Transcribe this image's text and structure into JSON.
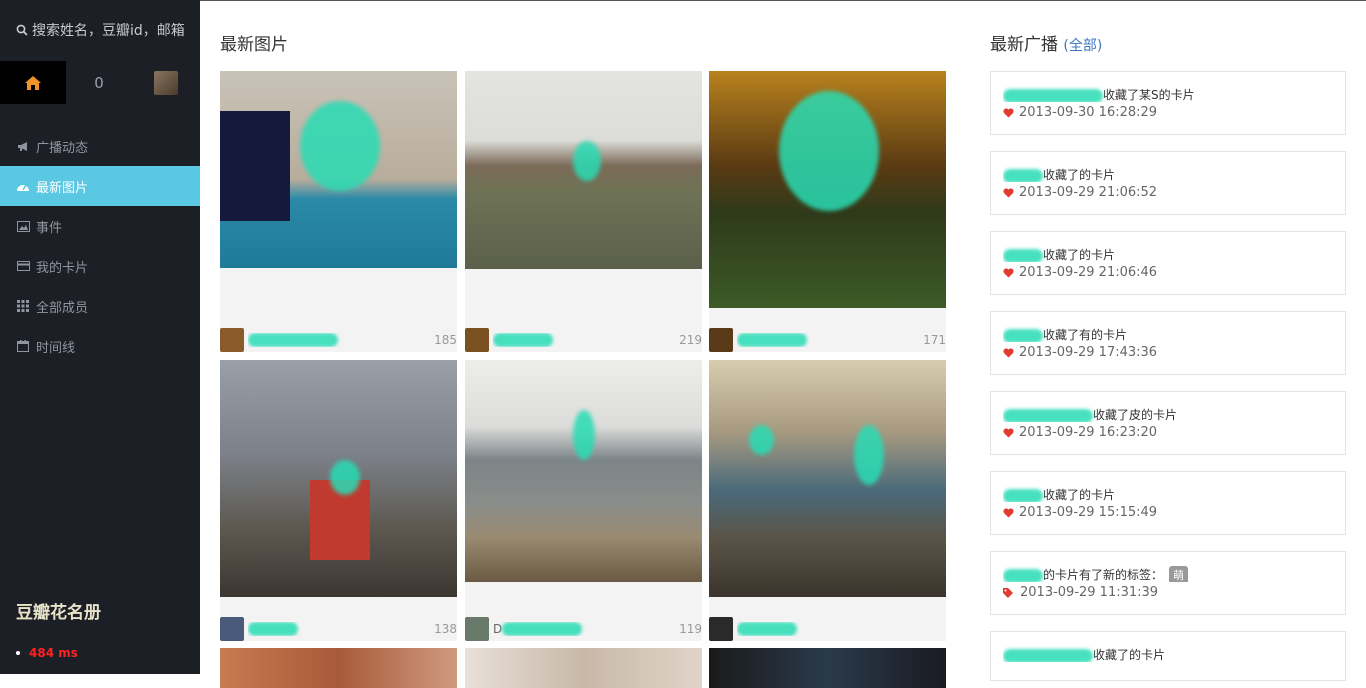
{
  "sidebar": {
    "search_placeholder": "搜索姓名，豆瓣id，邮箱",
    "count": "0",
    "nav": [
      {
        "label": "广播动态",
        "icon": "bullhorn-icon"
      },
      {
        "label": "最新图片",
        "icon": "dashboard-icon",
        "active": true
      },
      {
        "label": "事件",
        "icon": "picture-icon"
      },
      {
        "label": "我的卡片",
        "icon": "credit-card-icon"
      },
      {
        "label": "全部成员",
        "icon": "grid-icon"
      },
      {
        "label": "时间线",
        "icon": "calendar-icon"
      }
    ],
    "brand": "豆瓣花名册",
    "timing": "484 ms"
  },
  "photos": {
    "title": "最新图片",
    "items": [
      {
        "name": "",
        "count": "185"
      },
      {
        "name": "",
        "count": "219"
      },
      {
        "name": "",
        "count": "171"
      },
      {
        "name": "",
        "count": "138"
      },
      {
        "name": "D",
        "count": "119"
      },
      {
        "name": "",
        "count": ""
      }
    ]
  },
  "feed": {
    "title": "最新广播",
    "all_link": "(全部)",
    "items": [
      {
        "text": "收藏了某S的卡片",
        "time": "2013-09-30 16:28:29",
        "icon": "heart-icon"
      },
      {
        "text": "收藏了的卡片",
        "time": "2013-09-29 21:06:52",
        "icon": "heart-icon"
      },
      {
        "text": "收藏了的卡片",
        "time": "2013-09-29 21:06:46",
        "icon": "heart-icon"
      },
      {
        "text": "收藏了有的卡片",
        "time": "2013-09-29 17:43:36",
        "icon": "heart-icon"
      },
      {
        "text": "收藏了皮的卡片",
        "time": "2013-09-29 16:23:20",
        "icon": "heart-icon"
      },
      {
        "text": "收藏了的卡片",
        "time": "2013-09-29 15:15:49",
        "icon": "heart-icon"
      },
      {
        "text": "的卡片有了新的标签：",
        "tag": "萌",
        "time": "2013-09-29 11:31:39",
        "icon": "tags-icon"
      },
      {
        "text": "收藏了的卡片",
        "time": "",
        "icon": "heart-icon"
      }
    ]
  },
  "colors": {
    "sidebar_bg": "#1c1f26",
    "active_nav": "#5bc8e3",
    "home_icon": "#f0932b",
    "heart": "#e03c31",
    "timing": "#ff2222",
    "link": "#3a78c3"
  }
}
